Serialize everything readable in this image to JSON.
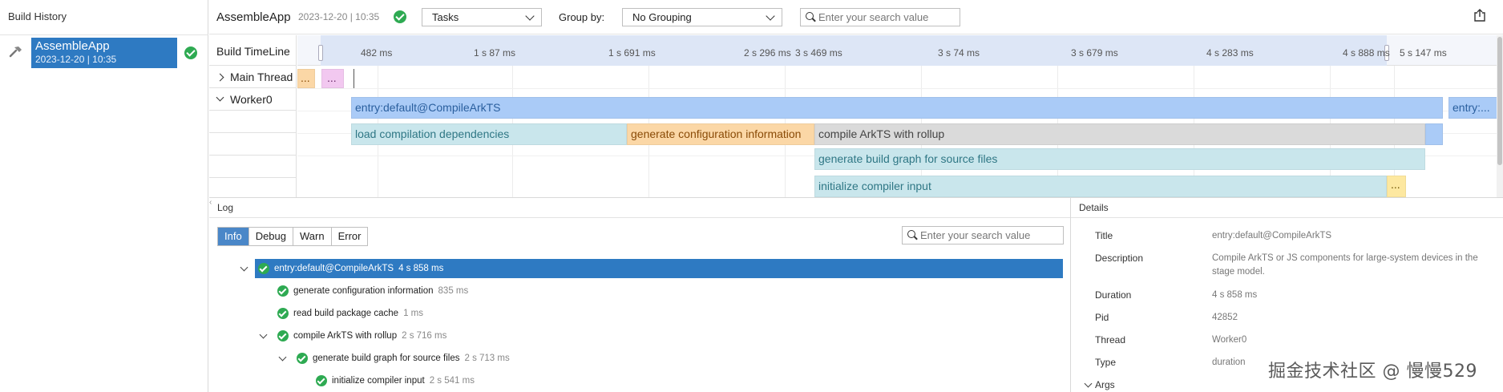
{
  "sidebar": {
    "title": "Build History",
    "build": {
      "name": "AssembleApp",
      "date": "2023-12-20 | 10:35"
    }
  },
  "header": {
    "app_name": "AssembleApp",
    "app_date": "2023-12-20 | 10:35",
    "tasks_select": "Tasks",
    "group_by_label": "Group by:",
    "grouping_select": "No Grouping",
    "search_placeholder": "Enter your search value"
  },
  "timeline": {
    "head_label": "Build TimeLine",
    "rows": [
      {
        "label": "Main Thread",
        "expanded": false
      },
      {
        "label": "Worker0",
        "expanded": true
      }
    ],
    "ticks": [
      "482 ms",
      "1 s 87 ms",
      "1 s 691 ms",
      "2 s 296 ms",
      "3 s 469 ms",
      "3 s 74 ms",
      "3 s 679 ms",
      "4 s 283 ms",
      "4 s 888 ms",
      "5 s 147 ms"
    ],
    "tick_overlap": "2 s",
    "bars": [
      {
        "label": "...",
        "color": "orange"
      },
      {
        "label": "...",
        "color": "pink"
      },
      {
        "label": "entry:default@CompileArkTS",
        "color": "blue"
      },
      {
        "label": "entry:...",
        "color": "blue"
      },
      {
        "label": "load compilation dependencies",
        "color": "teal"
      },
      {
        "label": "generate configuration information",
        "color": "orange"
      },
      {
        "label": "compile ArkTS with rollup",
        "color": "gray"
      },
      {
        "label": "",
        "color": "blue"
      },
      {
        "label": "generate build graph for source files",
        "color": "teal"
      },
      {
        "label": "initialize compiler input",
        "color": "teal"
      },
      {
        "label": "...",
        "color": "yellow"
      }
    ]
  },
  "log": {
    "title": "Log",
    "filters": [
      "Info",
      "Debug",
      "Warn",
      "Error"
    ],
    "active_filter": "Info",
    "search_placeholder": "Enter your search value",
    "entries": [
      {
        "name": "entry:default@CompileArkTS",
        "duration": "4 s 858 ms"
      },
      {
        "name": "generate configuration information",
        "duration": "835 ms"
      },
      {
        "name": "read build package cache",
        "duration": "1 ms"
      },
      {
        "name": "compile ArkTS with rollup",
        "duration": "2 s 716 ms"
      },
      {
        "name": "generate build graph for source files",
        "duration": "2 s 713 ms"
      },
      {
        "name": "initialize compiler input",
        "duration": "2 s 541 ms"
      }
    ]
  },
  "details": {
    "title": "Details",
    "fields": [
      {
        "key": "Title",
        "value": "entry:default@CompileArkTS"
      },
      {
        "key": "Description",
        "value": "Compile ArkTS or JS components for large-system devices in the stage model."
      },
      {
        "key": "Duration",
        "value": "4 s 858 ms"
      },
      {
        "key": "Pid",
        "value": "42852"
      },
      {
        "key": "Thread",
        "value": "Worker0"
      },
      {
        "key": "Type",
        "value": "duration"
      }
    ],
    "args_label": "Args"
  },
  "watermark": "掘金技术社区 @ 慢慢529",
  "colors": {
    "accent": "#2e7ac2",
    "success": "#2eaa52"
  }
}
